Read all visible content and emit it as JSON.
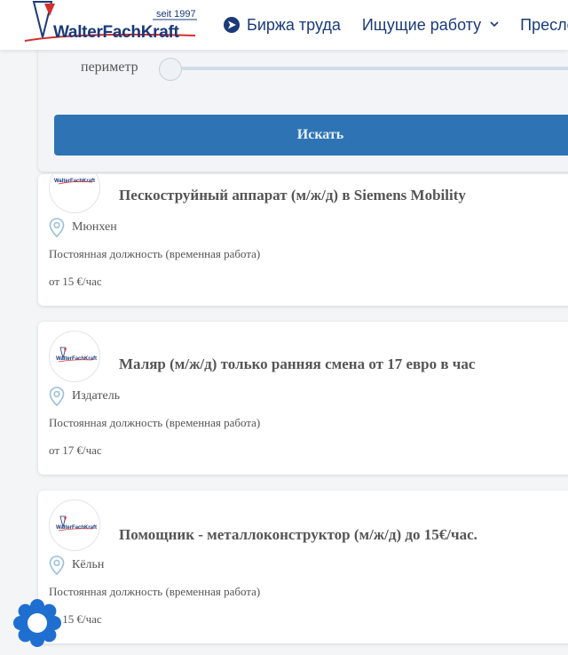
{
  "header": {
    "logo_since": "seit 1997",
    "logo_brand": "WalterFachKraft",
    "nav": [
      {
        "label": "Биржа труда",
        "icon": "navigation-arrow-icon"
      },
      {
        "label": "Ищущие работу",
        "icon": "chevron-down-icon"
      },
      {
        "label": "Пресле"
      }
    ]
  },
  "search": {
    "perimeter_label": "периметр",
    "perimeter_value": 0,
    "submit_label": "Искать"
  },
  "jobs": [
    {
      "title": "Пескоструйный аппарат (м/ж/д) в Siemens Mobility",
      "location": "Мюнхен",
      "employment": "Постоянная должность (временная работа)",
      "wage": "от 15 €/час"
    },
    {
      "title": "Маляр (м/ж/д) только ранняя смена от 17 евро в час",
      "location": "Издатель",
      "employment": "Постоянная должность (временная работа)",
      "wage": "от 17 €/час"
    },
    {
      "title": "Помощник - металлоконструктор (м/ж/д) до 15€/час.",
      "location": "Кёльн",
      "employment": "Постоянная должность (временная работа)",
      "wage": "от 15 €/час"
    }
  ],
  "colors": {
    "brand_blue": "#1a3a7a",
    "brand_red": "#d32f2f",
    "button_blue": "#2e74b5",
    "pin_blue": "#9bbfd9",
    "chat_blue": "#1f6fd1"
  }
}
